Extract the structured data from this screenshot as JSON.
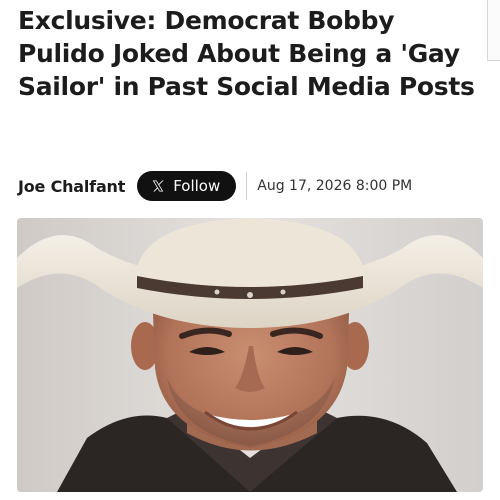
{
  "article": {
    "headline": "Exclusive: Democrat Bobby Pulido Joked About Being a 'Gay Sailor' in Past Social Media Posts",
    "author": "Joe Chalfant",
    "follow_label": "Follow",
    "date": "Aug 17, 2026 8:00 PM"
  },
  "icons": {
    "follow": "x-logo-icon"
  },
  "colors": {
    "follow_button_bg": "#111111",
    "text": "#1c1c1c"
  }
}
